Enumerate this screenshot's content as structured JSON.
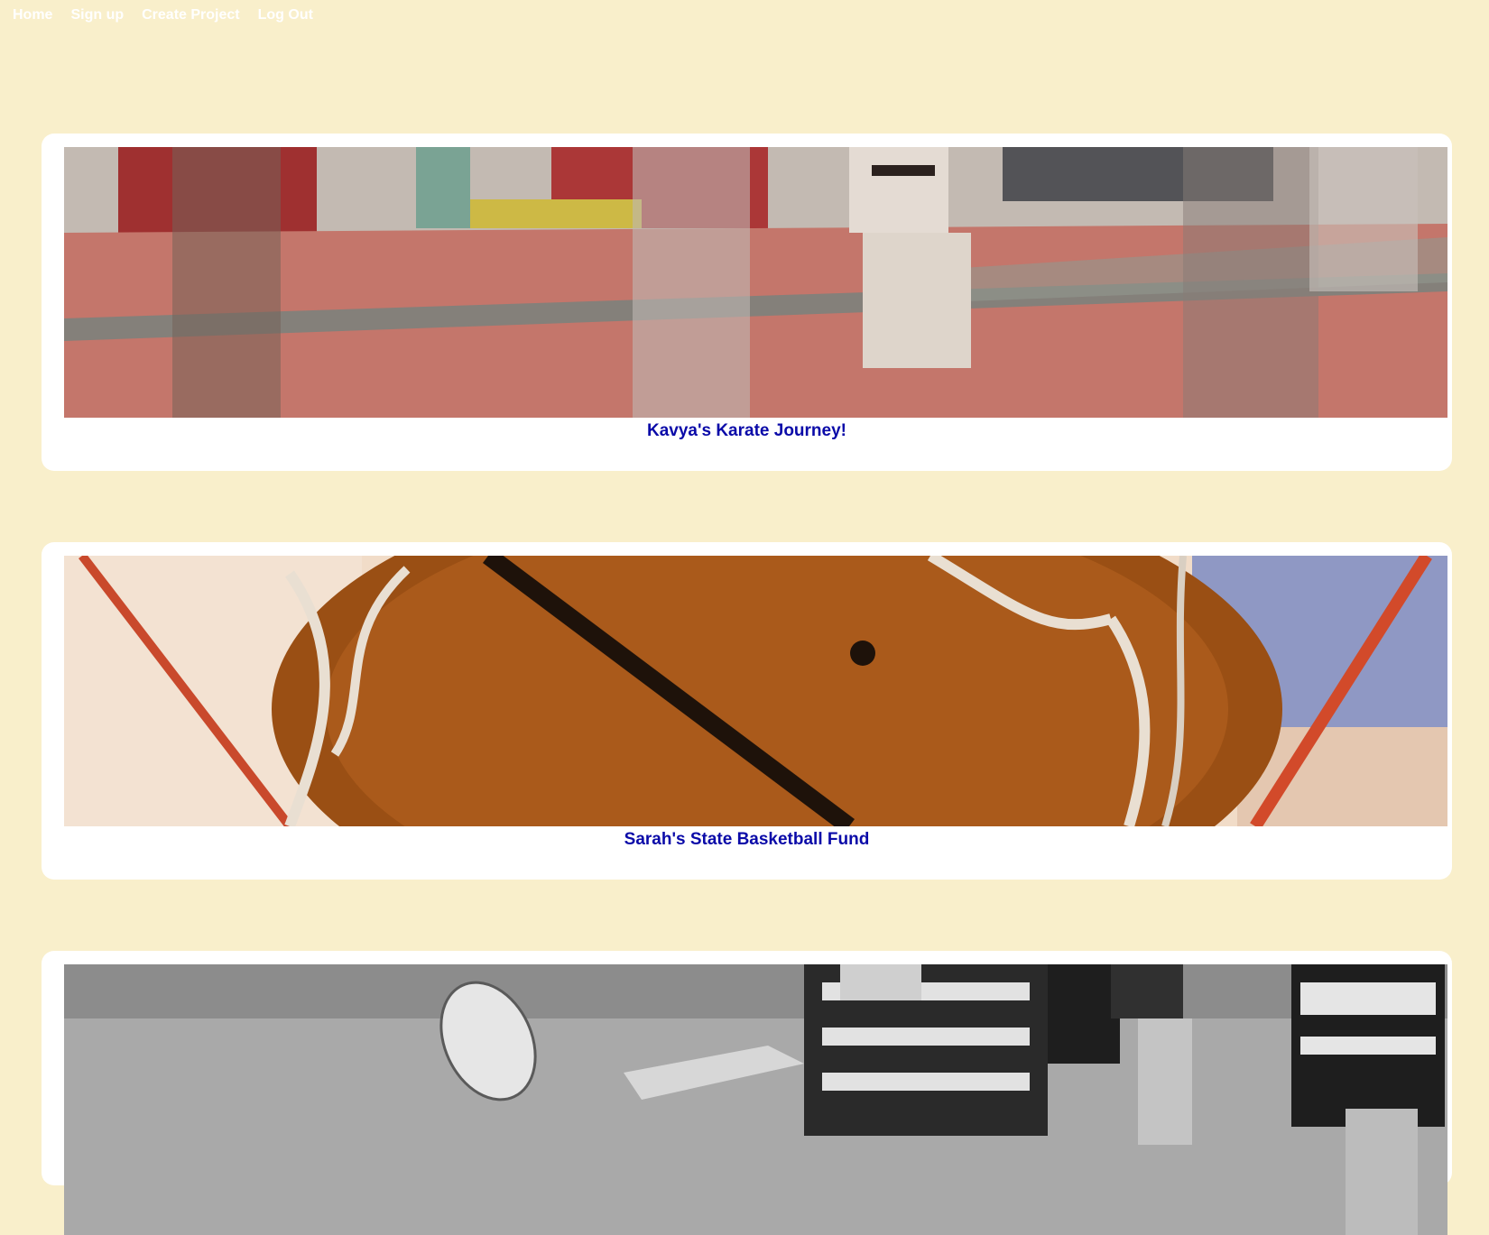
{
  "nav": {
    "home": "Home",
    "signup": "Sign up",
    "create_project": "Create Project",
    "logout": "Log Out"
  },
  "projects": [
    {
      "title": "Kavya's Karate Journey!",
      "image": "karate-dojo-photo"
    },
    {
      "title": "Sarah's State Basketball Fund",
      "image": "basketball-net-photo"
    },
    {
      "title": "",
      "image": "rugby-match-photo"
    }
  ],
  "colors": {
    "background": "#f9efcb",
    "card": "#ffffff",
    "link": "#0a0aa8",
    "nav_text": "#ffffff"
  }
}
